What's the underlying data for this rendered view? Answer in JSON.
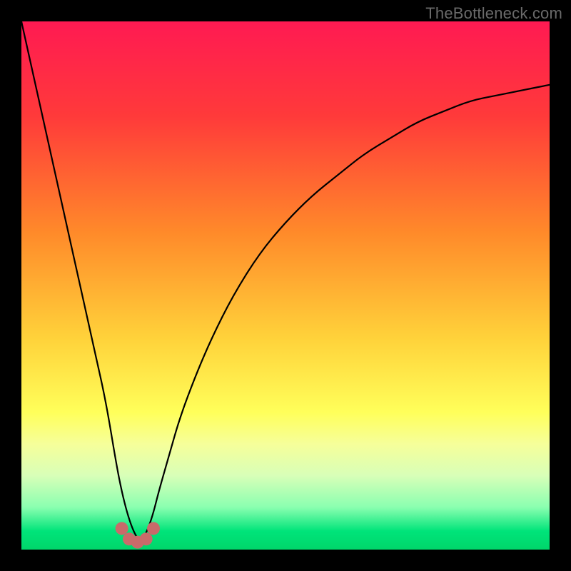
{
  "watermark": "TheBottleneck.com",
  "chart_data": {
    "type": "line",
    "title": "",
    "xlabel": "",
    "ylabel": "",
    "xlim": [
      0,
      100
    ],
    "ylim": [
      0,
      100
    ],
    "grid": false,
    "legend": false,
    "background_gradient_stops": [
      {
        "offset": 0,
        "color": "#ff1a52"
      },
      {
        "offset": 0.18,
        "color": "#ff3a3a"
      },
      {
        "offset": 0.4,
        "color": "#ff8a2a"
      },
      {
        "offset": 0.6,
        "color": "#ffd23a"
      },
      {
        "offset": 0.74,
        "color": "#ffff5a"
      },
      {
        "offset": 0.8,
        "color": "#f6ff9a"
      },
      {
        "offset": 0.86,
        "color": "#d8ffb8"
      },
      {
        "offset": 0.92,
        "color": "#8affb0"
      },
      {
        "offset": 0.965,
        "color": "#00e47a"
      },
      {
        "offset": 1.0,
        "color": "#00d66a"
      }
    ],
    "series": [
      {
        "name": "bottleneck-curve",
        "color": "#000000",
        "width": 2.2,
        "x": [
          0,
          2,
          4,
          6,
          8,
          10,
          12,
          14,
          16,
          18,
          19,
          20,
          21,
          22,
          23,
          24,
          25,
          26,
          28,
          30,
          33,
          36,
          40,
          45,
          50,
          55,
          60,
          65,
          70,
          75,
          80,
          85,
          90,
          95,
          100
        ],
        "y": [
          100,
          91,
          82,
          73,
          64,
          55,
          46,
          37,
          28,
          16,
          11,
          7,
          4,
          2,
          2,
          4,
          7,
          11,
          18,
          25,
          33,
          40,
          48,
          56,
          62,
          67,
          71,
          75,
          78,
          81,
          83,
          85,
          86,
          87,
          88
        ]
      }
    ],
    "markers": {
      "name": "valley-markers",
      "color": "#c96a6a",
      "radius": 9,
      "points": [
        {
          "x": 19.0,
          "y": 4.0
        },
        {
          "x": 20.4,
          "y": 2.0
        },
        {
          "x": 22.0,
          "y": 1.4
        },
        {
          "x": 23.6,
          "y": 2.0
        },
        {
          "x": 25.0,
          "y": 4.0
        }
      ]
    }
  }
}
